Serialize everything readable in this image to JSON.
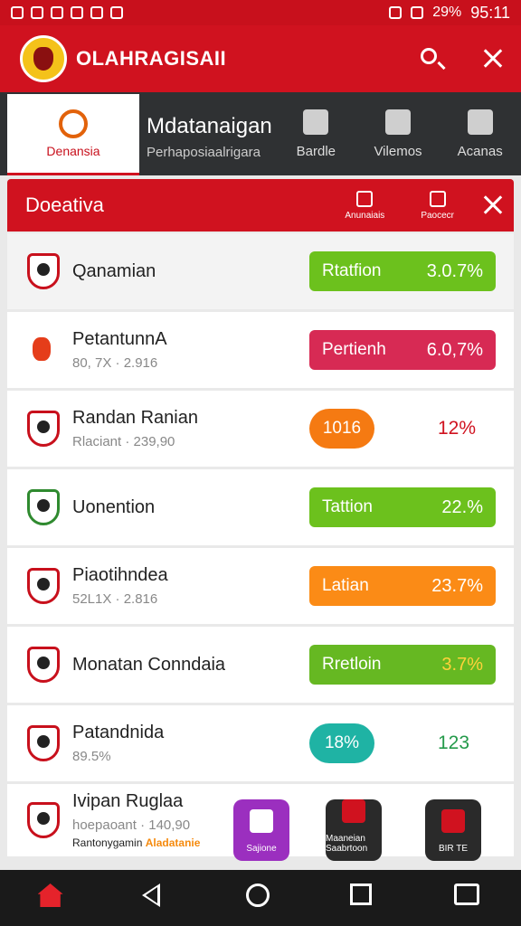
{
  "status": {
    "battery": "29%",
    "time": "95:11"
  },
  "appbar": {
    "title": "OLAHRAGISAII"
  },
  "tabs": {
    "active": "Denansia",
    "main_title": "Mdatanaigan",
    "main_sub": "Perhaposiaalrigara",
    "items": [
      "Bardle",
      "Vilemos",
      "Acanas"
    ]
  },
  "panel": {
    "title": "Doeativa",
    "mini": [
      "Anunaiais",
      "Paocecr"
    ]
  },
  "rows": [
    {
      "name": "Qanamian",
      "sub": "",
      "pill_label": "Rtatfion",
      "pill_value": "3.0.7%"
    },
    {
      "name": "PetantunnA",
      "sub": "80, 7X  ·  2.916",
      "pill_label": "Pertienh",
      "pill_value": "6.0,7%"
    },
    {
      "name": "Randan Ranian",
      "sub": "Rlaciant  ·  239,90",
      "chip": "1016",
      "side_value": "12%"
    },
    {
      "name": "Uonention",
      "sub": "",
      "pill_label": "Tattion",
      "pill_value": "22.%"
    },
    {
      "name": "Piaotihndea",
      "sub": "52L1X  ·  2.816",
      "pill_label": "Latian",
      "pill_value": "23.7%"
    },
    {
      "name": "Monatan Conndaia",
      "sub": "",
      "pill_label": "Rretloin",
      "pill_value": "3.7%"
    },
    {
      "name": "Patandnida",
      "sub": "89.5%",
      "chip": "18%",
      "side_value": "123"
    },
    {
      "name": "Ivipan Ruglaa",
      "sub": "hoepaoant  ·  140,90",
      "tiny": "Rantonygamin",
      "tiny_accent": "Aladatanie"
    }
  ],
  "launchers": [
    "Sajione",
    "Maaneian Saabrtoon",
    "BIR TE"
  ],
  "colors": {
    "brand_red": "#d0121f",
    "green": "#6cc11d",
    "pink": "#d72a54",
    "orange": "#fb8b16",
    "teal": "#1fb3a4"
  },
  "icons": {
    "search": "search-icon",
    "close": "close-icon",
    "home": "home-icon"
  }
}
